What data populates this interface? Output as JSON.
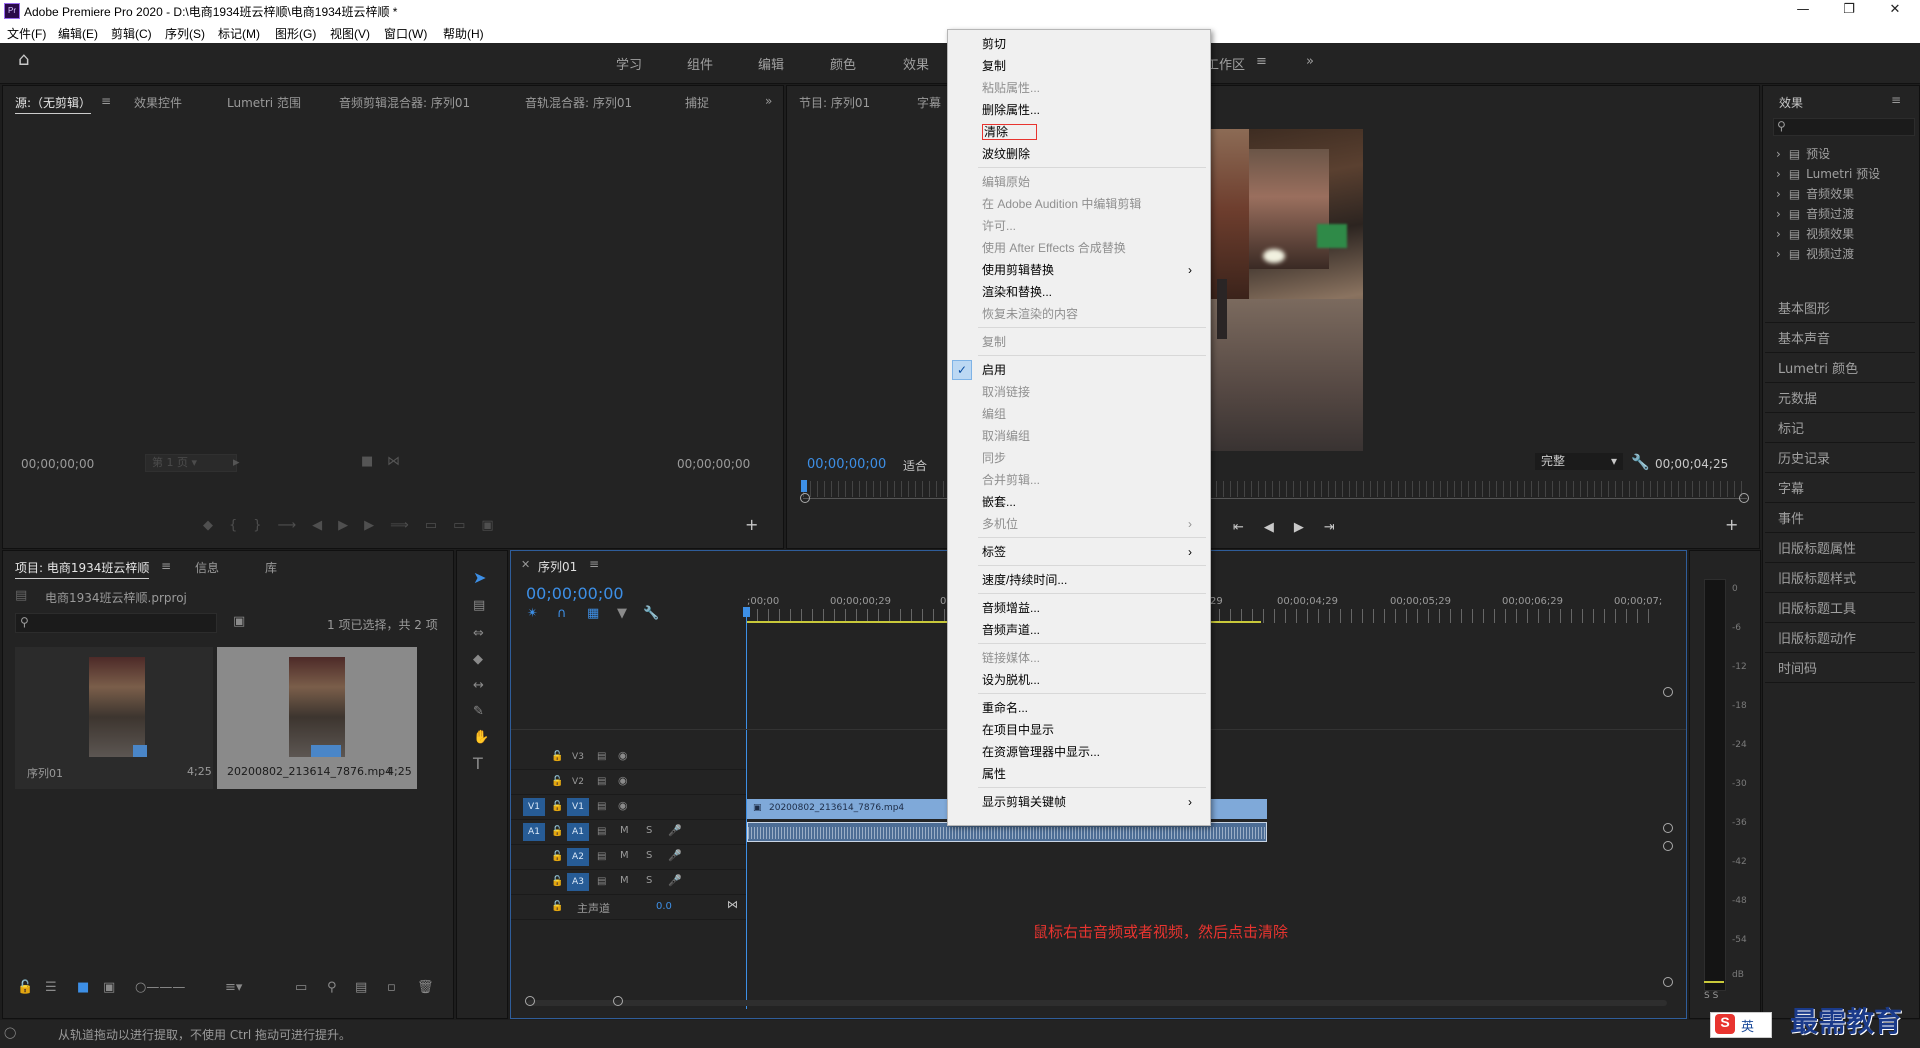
{
  "title_bar": {
    "logo": "Pr",
    "title": "Adobe Premiere Pro 2020 - D:\\电商1934班云梓顺\\电商1934班云梓顺 *"
  },
  "menu": [
    "文件(F)",
    "编辑(E)",
    "剪辑(C)",
    "序列(S)",
    "标记(M)",
    "图形(G)",
    "视图(V)",
    "窗口(W)",
    "帮助(H)"
  ],
  "workspaces": [
    "学习",
    "组件",
    "编辑",
    "颜色",
    "效果"
  ],
  "workspace_active": "工作区",
  "source_panel": {
    "tabs": [
      "源:（无剪辑）",
      "效果控件",
      "Lumetri 范围",
      "音频剪辑混合器: 序列01",
      "音轨混合器: 序列01",
      "捕捉"
    ],
    "tc_left": "00;00;00;00",
    "page_select": "第 1 页",
    "tc_right": "00;00;00;00"
  },
  "program_panel": {
    "tabs": [
      "节目: 序列01",
      "字幕"
    ],
    "tc_left": "00;00;00;00",
    "fit": "适合",
    "quality": "完整",
    "tc_right": "00;00;04;25"
  },
  "project_panel": {
    "tabs": [
      "项目: 电商1934班云梓顺",
      "信息",
      "库"
    ],
    "file": "电商1934班云梓顺.prproj",
    "status": "1 项已选择，共 2 项",
    "items": [
      {
        "name": "序列01",
        "duration": "4;25"
      },
      {
        "name": "20200802_213614_7876.mp4",
        "duration": "4;25"
      }
    ]
  },
  "timeline": {
    "tab": "序列01",
    "timecode": "00;00;00;00",
    "ruler": [
      ";00;00",
      "00;00;00;29",
      "0",
      "29",
      "00;00;04;29",
      "00;00;05;29",
      "00;00;06;29",
      "00;00;07;"
    ],
    "video_tracks": [
      "V3",
      "V2",
      "V1"
    ],
    "audio_tracks": [
      "A1",
      "A2",
      "A3"
    ],
    "src_v": "V1",
    "src_a": "A1",
    "master": "主声道",
    "master_value": "0.0",
    "mute": "M",
    "solo": "S",
    "clip_name": "20200802_213614_7876.mp4",
    "annotation": "鼠标右击音频或者视频，然后点击清除"
  },
  "context_menu": {
    "groups": [
      [
        {
          "label": "剪切",
          "enabled": true
        },
        {
          "label": "复制",
          "enabled": true
        },
        {
          "label": "粘贴属性...",
          "enabled": false
        },
        {
          "label": "删除属性...",
          "enabled": true
        },
        {
          "label": "清除",
          "enabled": true,
          "highlighted": true
        },
        {
          "label": "波纹删除",
          "enabled": true
        }
      ],
      [
        {
          "label": "编辑原始",
          "enabled": false
        },
        {
          "label": "在 Adobe Audition 中编辑剪辑",
          "enabled": false
        },
        {
          "label": "许可...",
          "enabled": false
        },
        {
          "label": "使用 After Effects 合成替换",
          "enabled": false
        },
        {
          "label": "使用剪辑替换",
          "enabled": true,
          "submenu": true
        },
        {
          "label": "渲染和替换...",
          "enabled": true
        },
        {
          "label": "恢复未渲染的内容",
          "enabled": false
        }
      ],
      [
        {
          "label": "复制",
          "enabled": false
        }
      ],
      [
        {
          "label": "启用",
          "enabled": true,
          "checked": true
        },
        {
          "label": "取消链接",
          "enabled": false
        },
        {
          "label": "编组",
          "enabled": false
        },
        {
          "label": "取消编组",
          "enabled": false
        },
        {
          "label": "同步",
          "enabled": false
        },
        {
          "label": "合并剪辑...",
          "enabled": false
        },
        {
          "label": "嵌套...",
          "enabled": true
        },
        {
          "label": "多机位",
          "enabled": false,
          "submenu": true
        }
      ],
      [
        {
          "label": "标签",
          "enabled": true,
          "submenu": true
        }
      ],
      [
        {
          "label": "速度/持续时间...",
          "enabled": true
        }
      ],
      [
        {
          "label": "音频增益...",
          "enabled": true
        },
        {
          "label": "音频声道...",
          "enabled": true
        }
      ],
      [
        {
          "label": "链接媒体...",
          "enabled": false
        },
        {
          "label": "设为脱机...",
          "enabled": true
        }
      ],
      [
        {
          "label": "重命名...",
          "enabled": true
        },
        {
          "label": "在项目中显示",
          "enabled": true
        },
        {
          "label": "在资源管理器中显示...",
          "enabled": true
        },
        {
          "label": "属性",
          "enabled": true
        }
      ],
      [
        {
          "label": "显示剪辑关键帧",
          "enabled": true,
          "submenu": true
        }
      ]
    ]
  },
  "effects_panel": {
    "title": "效果",
    "tree": [
      "预设",
      "Lumetri 预设",
      "音频效果",
      "音频过渡",
      "视频效果",
      "视频过渡"
    ],
    "panels": [
      "基本图形",
      "基本声音",
      "Lumetri 颜色",
      "元数据",
      "标记",
      "历史记录",
      "字幕",
      "事件",
      "旧版标题属性",
      "旧版标题样式",
      "旧版标题工具",
      "旧版标题动作",
      "时间码"
    ]
  },
  "meter": {
    "ticks": [
      "0",
      "-6",
      "-12",
      "-18",
      "-24",
      "-30",
      "-36",
      "-42",
      "-48",
      "-54",
      "dB"
    ],
    "solo": "S  S"
  },
  "status_bar": "从轨道拖动以进行提取，不使用 Ctrl 拖动可进行提升。",
  "watermark": "最需教育",
  "ime": "英",
  "colors": {
    "accent": "#3d8fe6",
    "annotation": "#e8342f",
    "clip_video": "#7fa9d9",
    "clip_audio": "#4d6d95"
  }
}
